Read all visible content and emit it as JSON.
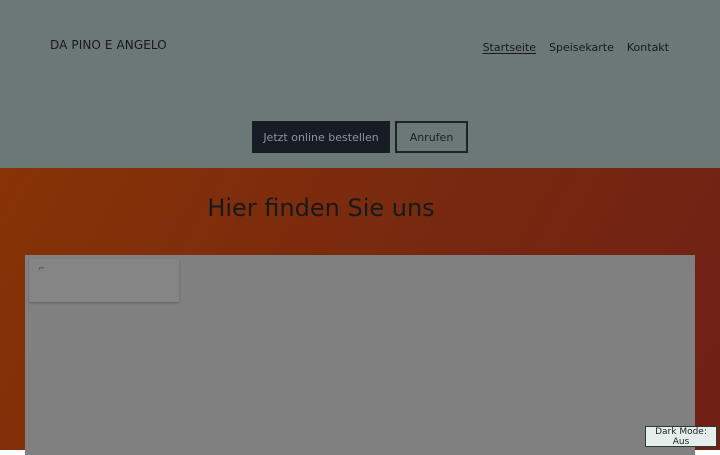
{
  "header": {
    "brand": "DA PINO E ANGELO",
    "nav": [
      "Startseite",
      "Speisekarte",
      "Kontakt"
    ],
    "buttons": {
      "order": "Jetzt online bestellen",
      "call": "Anrufen"
    }
  },
  "hero": {
    "title": "Hier finden Sie uns",
    "map_card_glyph": "⌐"
  },
  "dark_mode_toggle": "Dark Mode: Aus",
  "colors": {
    "header_bg": "#6c7876",
    "hero_bg": "#7a2a0e",
    "primary_button": "#171c24"
  }
}
